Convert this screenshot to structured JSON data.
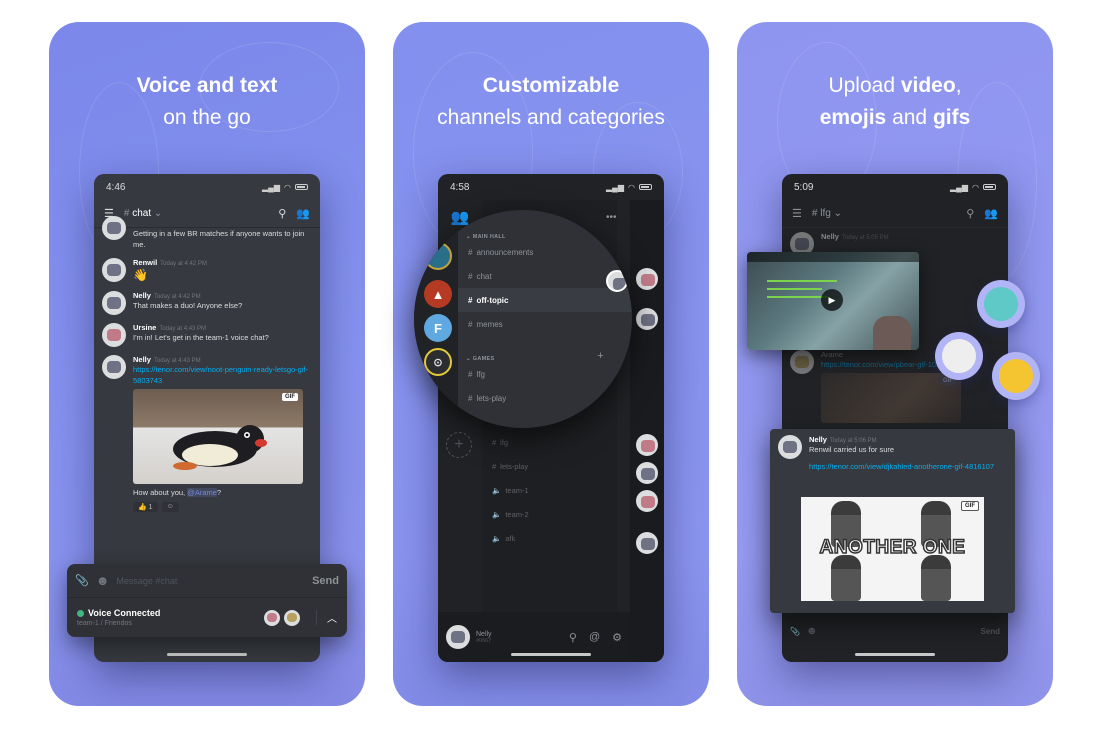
{
  "cards": [
    {
      "headline_bold": "Voice and text",
      "headline_rest": "on the go",
      "phone": {
        "time": "4:46",
        "channel": "chat",
        "messages": [
          {
            "author": "",
            "time": "",
            "text": "Getting in a few BR matches if anyone wants to join me."
          },
          {
            "author": "Renwil",
            "time": "Today at 4:42 PM",
            "text": "👋"
          },
          {
            "author": "Nelly",
            "time": "Today at 4:42 PM",
            "text": "That makes a duo! Anyone else?"
          },
          {
            "author": "Ursine",
            "time": "Today at 4:43 PM",
            "text": "I'm in! Let's get in the team-1 voice chat?"
          },
          {
            "author": "Nelly",
            "time": "Today at 4:43 PM",
            "link": "https://tenor.com/view/noot-penguin-ready-letsgo-gif-5803743",
            "gif_label": "GIF",
            "followup_prefix": "How about you, ",
            "mention": "@Arame",
            "followup_suffix": "?",
            "reaction_emoji": "👍",
            "reaction_count": "1"
          }
        ],
        "input_placeholder": "Message #chat",
        "send_label": "Send",
        "voice": {
          "title": "Voice Connected",
          "subtitle": "team-1 / Friendos",
          "status_color": "#43b581"
        }
      }
    },
    {
      "headline_bold": "Customizable",
      "headline_rest": "channels and categories",
      "phone": {
        "time": "4:58",
        "categories": [
          {
            "name": "MAIN HALL",
            "channels": [
              "announcements",
              "chat",
              "off-topic",
              "memes"
            ],
            "active": "off-topic"
          },
          {
            "name": "GAMES",
            "channels": [
              "lfg",
              "lets-play"
            ]
          }
        ],
        "background_channels": [
          "lfg",
          "lets-play"
        ],
        "voice_channels": [
          "team-1",
          "team-2",
          "afk"
        ],
        "servers": [
          "Apex",
          "Fortnite",
          "Overwatch"
        ],
        "user": {
          "name": "Nelly",
          "tag": "#0667"
        }
      }
    },
    {
      "headline_plain_1": "Upload ",
      "headline_bold_1": "video",
      "headline_plain_2": ",",
      "headline_bold_2": "emojis",
      "headline_plain_3": " and ",
      "headline_bold_3": "gifs",
      "phone": {
        "time": "5:09",
        "channel": "lfg",
        "bg_messages": [
          {
            "author": "Nelly",
            "time": "Today at 5:05 PM"
          },
          {
            "author": "Arame",
            "link": "https://tenor.com/view/pbear-gif-10241261",
            "gif_label": "GIF"
          }
        ],
        "popup_message": {
          "author": "Nelly",
          "time": "Today at 5:06 PM",
          "text": "Renwil carried us for sure",
          "link": "https://tenor.com/view/djkahled-anotherone-gif-4816107",
          "gif_label": "GIF",
          "gif_caption": "ANOTHER ONE"
        },
        "send_label": "Send"
      }
    }
  ],
  "colors": {
    "brand": "#7b88ea",
    "link": "#00b0f4",
    "online": "#43b581"
  }
}
